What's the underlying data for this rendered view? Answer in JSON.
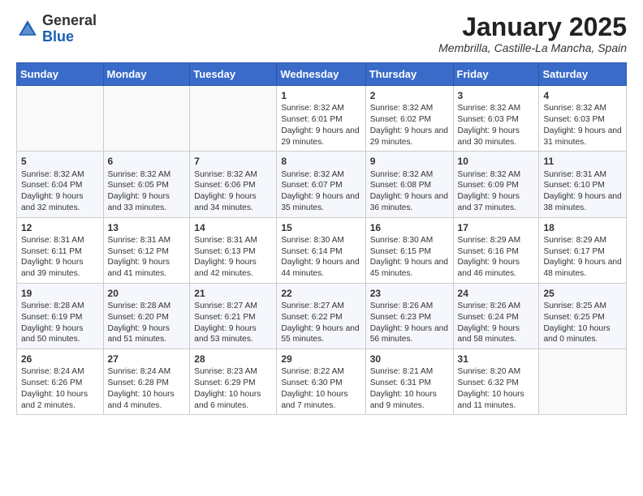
{
  "header": {
    "logo_general": "General",
    "logo_blue": "Blue",
    "month_title": "January 2025",
    "location": "Membrilla, Castille-La Mancha, Spain"
  },
  "weekdays": [
    "Sunday",
    "Monday",
    "Tuesday",
    "Wednesday",
    "Thursday",
    "Friday",
    "Saturday"
  ],
  "weeks": [
    [
      {
        "day": "",
        "info": ""
      },
      {
        "day": "",
        "info": ""
      },
      {
        "day": "",
        "info": ""
      },
      {
        "day": "1",
        "info": "Sunrise: 8:32 AM\nSunset: 6:01 PM\nDaylight: 9 hours and 29 minutes."
      },
      {
        "day": "2",
        "info": "Sunrise: 8:32 AM\nSunset: 6:02 PM\nDaylight: 9 hours and 29 minutes."
      },
      {
        "day": "3",
        "info": "Sunrise: 8:32 AM\nSunset: 6:03 PM\nDaylight: 9 hours and 30 minutes."
      },
      {
        "day": "4",
        "info": "Sunrise: 8:32 AM\nSunset: 6:03 PM\nDaylight: 9 hours and 31 minutes."
      }
    ],
    [
      {
        "day": "5",
        "info": "Sunrise: 8:32 AM\nSunset: 6:04 PM\nDaylight: 9 hours and 32 minutes."
      },
      {
        "day": "6",
        "info": "Sunrise: 8:32 AM\nSunset: 6:05 PM\nDaylight: 9 hours and 33 minutes."
      },
      {
        "day": "7",
        "info": "Sunrise: 8:32 AM\nSunset: 6:06 PM\nDaylight: 9 hours and 34 minutes."
      },
      {
        "day": "8",
        "info": "Sunrise: 8:32 AM\nSunset: 6:07 PM\nDaylight: 9 hours and 35 minutes."
      },
      {
        "day": "9",
        "info": "Sunrise: 8:32 AM\nSunset: 6:08 PM\nDaylight: 9 hours and 36 minutes."
      },
      {
        "day": "10",
        "info": "Sunrise: 8:32 AM\nSunset: 6:09 PM\nDaylight: 9 hours and 37 minutes."
      },
      {
        "day": "11",
        "info": "Sunrise: 8:31 AM\nSunset: 6:10 PM\nDaylight: 9 hours and 38 minutes."
      }
    ],
    [
      {
        "day": "12",
        "info": "Sunrise: 8:31 AM\nSunset: 6:11 PM\nDaylight: 9 hours and 39 minutes."
      },
      {
        "day": "13",
        "info": "Sunrise: 8:31 AM\nSunset: 6:12 PM\nDaylight: 9 hours and 41 minutes."
      },
      {
        "day": "14",
        "info": "Sunrise: 8:31 AM\nSunset: 6:13 PM\nDaylight: 9 hours and 42 minutes."
      },
      {
        "day": "15",
        "info": "Sunrise: 8:30 AM\nSunset: 6:14 PM\nDaylight: 9 hours and 44 minutes."
      },
      {
        "day": "16",
        "info": "Sunrise: 8:30 AM\nSunset: 6:15 PM\nDaylight: 9 hours and 45 minutes."
      },
      {
        "day": "17",
        "info": "Sunrise: 8:29 AM\nSunset: 6:16 PM\nDaylight: 9 hours and 46 minutes."
      },
      {
        "day": "18",
        "info": "Sunrise: 8:29 AM\nSunset: 6:17 PM\nDaylight: 9 hours and 48 minutes."
      }
    ],
    [
      {
        "day": "19",
        "info": "Sunrise: 8:28 AM\nSunset: 6:19 PM\nDaylight: 9 hours and 50 minutes."
      },
      {
        "day": "20",
        "info": "Sunrise: 8:28 AM\nSunset: 6:20 PM\nDaylight: 9 hours and 51 minutes."
      },
      {
        "day": "21",
        "info": "Sunrise: 8:27 AM\nSunset: 6:21 PM\nDaylight: 9 hours and 53 minutes."
      },
      {
        "day": "22",
        "info": "Sunrise: 8:27 AM\nSunset: 6:22 PM\nDaylight: 9 hours and 55 minutes."
      },
      {
        "day": "23",
        "info": "Sunrise: 8:26 AM\nSunset: 6:23 PM\nDaylight: 9 hours and 56 minutes."
      },
      {
        "day": "24",
        "info": "Sunrise: 8:26 AM\nSunset: 6:24 PM\nDaylight: 9 hours and 58 minutes."
      },
      {
        "day": "25",
        "info": "Sunrise: 8:25 AM\nSunset: 6:25 PM\nDaylight: 10 hours and 0 minutes."
      }
    ],
    [
      {
        "day": "26",
        "info": "Sunrise: 8:24 AM\nSunset: 6:26 PM\nDaylight: 10 hours and 2 minutes."
      },
      {
        "day": "27",
        "info": "Sunrise: 8:24 AM\nSunset: 6:28 PM\nDaylight: 10 hours and 4 minutes."
      },
      {
        "day": "28",
        "info": "Sunrise: 8:23 AM\nSunset: 6:29 PM\nDaylight: 10 hours and 6 minutes."
      },
      {
        "day": "29",
        "info": "Sunrise: 8:22 AM\nSunset: 6:30 PM\nDaylight: 10 hours and 7 minutes."
      },
      {
        "day": "30",
        "info": "Sunrise: 8:21 AM\nSunset: 6:31 PM\nDaylight: 10 hours and 9 minutes."
      },
      {
        "day": "31",
        "info": "Sunrise: 8:20 AM\nSunset: 6:32 PM\nDaylight: 10 hours and 11 minutes."
      },
      {
        "day": "",
        "info": ""
      }
    ]
  ]
}
